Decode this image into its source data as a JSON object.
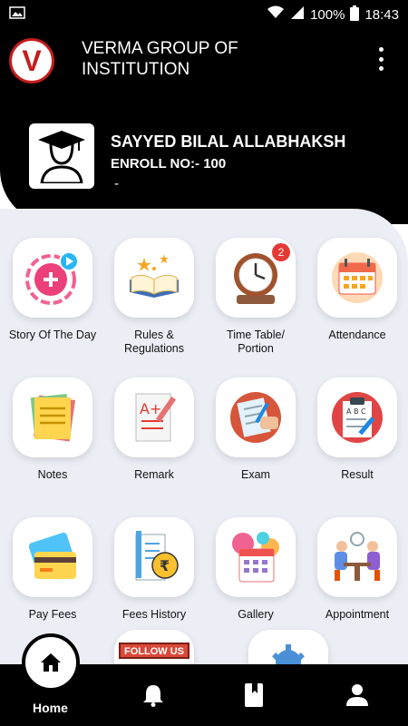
{
  "status_bar": {
    "battery": "100%",
    "time": "18:43"
  },
  "header": {
    "logo_letter": "V",
    "title": "VERMA GROUP OF INSTITUTION"
  },
  "profile": {
    "name": "SAYYED BILAL ALLABHAKSH",
    "enroll": "ENROLL NO:- 100",
    "extra": "-"
  },
  "tiles": [
    {
      "label": "Story Of The Day",
      "icon": "story-icon"
    },
    {
      "label": "Rules & Regulations",
      "icon": "book-icon"
    },
    {
      "label": "Time Table/ Portion",
      "icon": "clock-icon",
      "badge": "2"
    },
    {
      "label": "Attendance",
      "icon": "calendar-icon"
    },
    {
      "label": "Notes",
      "icon": "notes-icon"
    },
    {
      "label": "Remark",
      "icon": "remark-icon"
    },
    {
      "label": "Exam",
      "icon": "exam-icon"
    },
    {
      "label": "Result",
      "icon": "result-icon"
    },
    {
      "label": "Pay Fees",
      "icon": "cards-icon"
    },
    {
      "label": "Fees History",
      "icon": "receipt-icon"
    },
    {
      "label": "Gallery",
      "icon": "gallery-icon"
    },
    {
      "label": "Appointment",
      "icon": "meeting-icon"
    }
  ],
  "partial": {
    "follow_label": "FOLLOW US"
  },
  "nav": {
    "home_label": "Home"
  },
  "colors": {
    "accent_red": "#c41d1d",
    "badge_red": "#e53935",
    "header_bg": "#000000",
    "content_bg": "#eceef6"
  }
}
